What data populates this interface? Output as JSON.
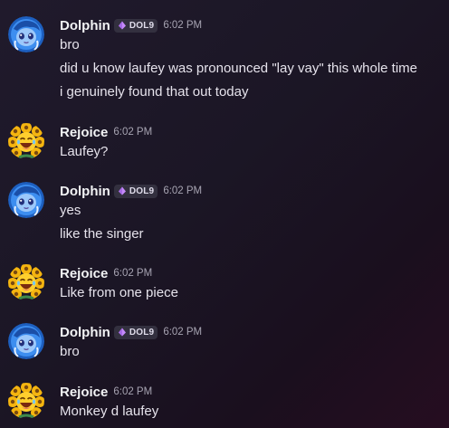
{
  "messages": [
    {
      "author": "Dolphin",
      "tag": "DOL9",
      "time": "6:02 PM",
      "lines": [
        "bro",
        "did u know laufey was pronounced \"lay vay\" this whole time",
        "i genuinely found that out today"
      ]
    },
    {
      "author": "Rejoice",
      "time": "6:02 PM",
      "lines": [
        "Laufey?"
      ]
    },
    {
      "author": "Dolphin",
      "tag": "DOL9",
      "time": "6:02 PM",
      "lines": [
        "yes",
        "like the singer"
      ]
    },
    {
      "author": "Rejoice",
      "time": "6:02 PM",
      "lines": [
        "Like from one piece"
      ]
    },
    {
      "author": "Dolphin",
      "tag": "DOL9",
      "time": "6:02 PM",
      "lines": [
        "bro"
      ]
    },
    {
      "author": "Rejoice",
      "time": "6:02 PM",
      "lines": [
        "Monkey d laufey"
      ]
    }
  ],
  "colors": {
    "tag_icon": "#c58af9",
    "dolphin_avatar": "#2f7fe0",
    "rejoice_avatar": "#f0b21a"
  },
  "icons": {
    "dolphin_avatar": "blue-anime-avatar",
    "rejoice_avatar": "laughing-emoji-sunflowers-avatar",
    "tag": "purple-gem-icon"
  }
}
